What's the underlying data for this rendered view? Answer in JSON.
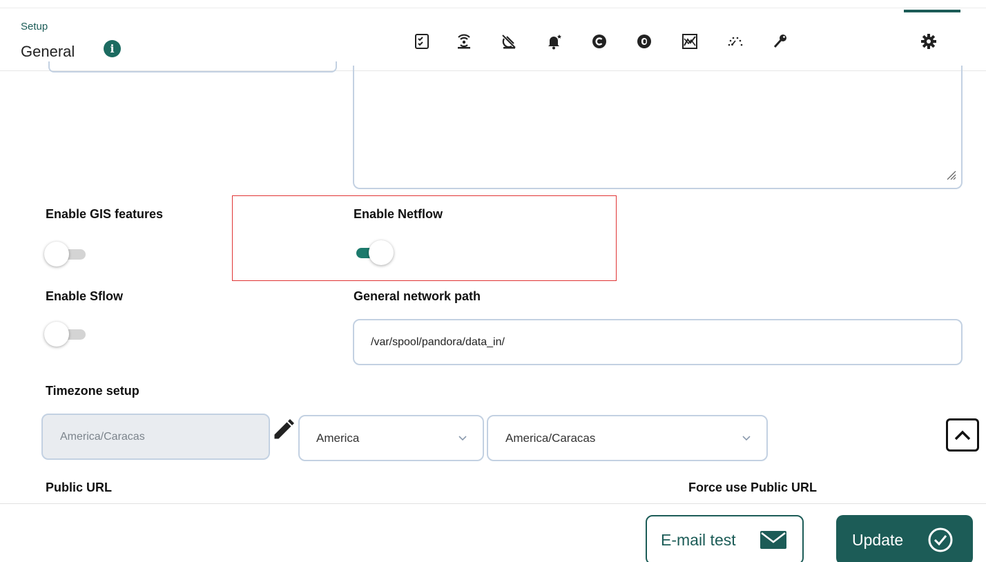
{
  "header": {
    "breadcrumb": "Setup",
    "title": "General",
    "info_icon": "info-circle-icon",
    "toolbar_icons": [
      "checklist-icon",
      "wireless-icon",
      "satellite-off-icon",
      "bell-star-icon",
      "copyright-circle-icon",
      "badge-circle-icon",
      "chart-graph-icon",
      "gauge-dots-icon",
      "key-icon",
      "gear-icon"
    ],
    "active_icon": "gear-icon"
  },
  "form": {
    "gis": {
      "label": "Enable GIS features",
      "enabled": false
    },
    "netflow": {
      "label": "Enable Netflow",
      "enabled": true
    },
    "sflow": {
      "label": "Enable Sflow",
      "enabled": false
    },
    "network_path": {
      "label": "General network path",
      "value": "/var/spool/pandora/data_in/"
    },
    "timezone": {
      "label": "Timezone setup",
      "current": "America/Caracas",
      "region": "America",
      "zone": "America/Caracas"
    },
    "public_url": {
      "label": "Public URL"
    },
    "force_public_url": {
      "label": "Force use Public URL"
    }
  },
  "footer": {
    "email_test_label": "E-mail test",
    "update_label": "Update"
  },
  "colors": {
    "accent": "#1c5c57",
    "toggle_on": "#1c7a6c",
    "highlight": "#e03434",
    "input_border": "#c3d1e2"
  }
}
